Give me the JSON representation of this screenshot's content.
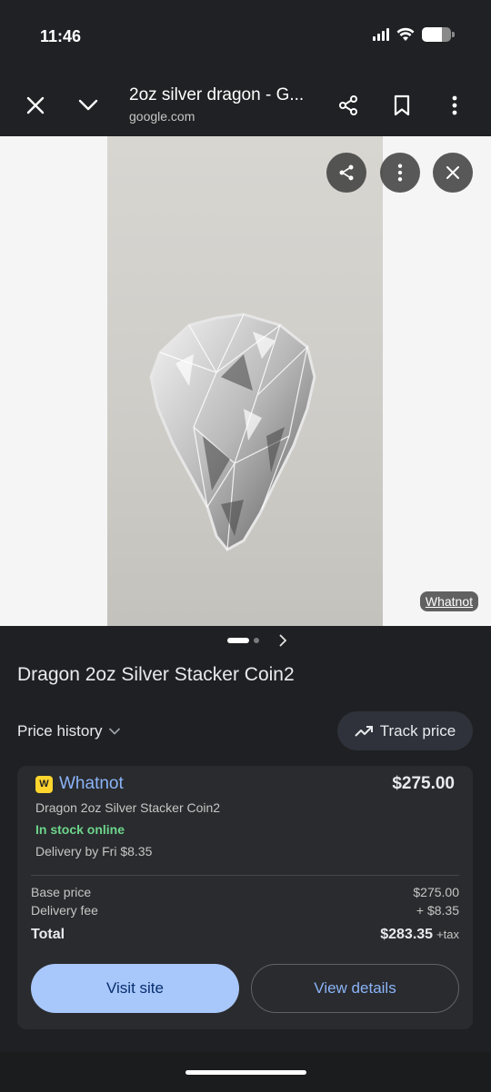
{
  "status_bar": {
    "time": "11:46"
  },
  "top_bar": {
    "title": "2oz silver dragon - G...",
    "url": "google.com"
  },
  "image_viewer": {
    "source_chip": "Whatnot"
  },
  "product": {
    "title": "Dragon 2oz Silver Stacker Coin2",
    "price_history_label": "Price history",
    "track_price_label": "Track price"
  },
  "offer": {
    "merchant": "Whatnot",
    "price": "$275.00",
    "description": "Dragon 2oz Silver Stacker Coin2",
    "stock": "In stock online",
    "delivery": "Delivery by Fri $8.35",
    "base_price_label": "Base price",
    "base_price": "$275.00",
    "delivery_fee_label": "Delivery fee",
    "delivery_fee": "+ $8.35",
    "total_label": "Total",
    "total": "$283.35",
    "tax_note": "+tax",
    "visit_button": "Visit site",
    "details_button": "View details"
  },
  "colors": {
    "accent": "#8ab4f8",
    "button_fill": "#a8c7fa",
    "in_stock": "#6dd58c",
    "background": "#1f2023"
  }
}
